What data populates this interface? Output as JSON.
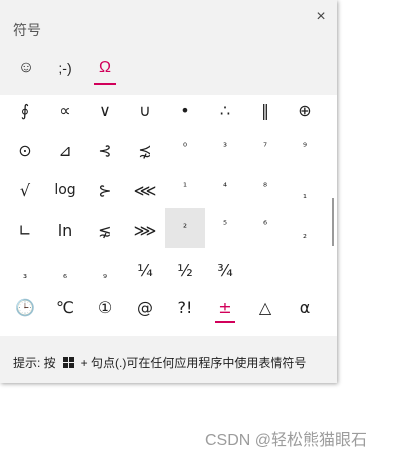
{
  "panel": {
    "title": "符号",
    "close_icon": "×",
    "tabs": [
      {
        "label": "☺",
        "icon": "smiley-icon"
      },
      {
        "label": ";-)",
        "icon": "kaomoji-icon"
      },
      {
        "label": "Ω",
        "icon": "symbol-icon"
      }
    ],
    "symbols": {
      "row1": [
        "∮",
        "∝",
        "∨",
        "∪",
        "•",
        "∴",
        "‖",
        "⊕"
      ],
      "row2": [
        "⊙",
        "⊿",
        "⊰",
        "⋨",
        "⁰",
        "³",
        "⁷",
        "⁹"
      ],
      "row3": [
        "√",
        "log",
        "⊱",
        "⋘",
        "¹",
        "⁴",
        "⁸",
        "₁"
      ],
      "row4": [
        "∟",
        "ln",
        "⋦",
        "⋙",
        "²",
        "⁵",
        "⁶",
        "₂"
      ],
      "row5": [
        "₃",
        "₆",
        "₉",
        "¼",
        "½",
        "¾",
        "",
        ""
      ],
      "row6": [
        "🕒",
        "℃",
        "①",
        "@",
        "?!",
        "±",
        "△",
        "α"
      ]
    },
    "hint": {
      "prefix": "提示: 按",
      "suffix": "+ 句点(.)可在任何应用程序中使用表情符号"
    }
  },
  "watermark": "CSDN @轻松熊猫眼石",
  "colors": {
    "accent": "#d1005a"
  }
}
